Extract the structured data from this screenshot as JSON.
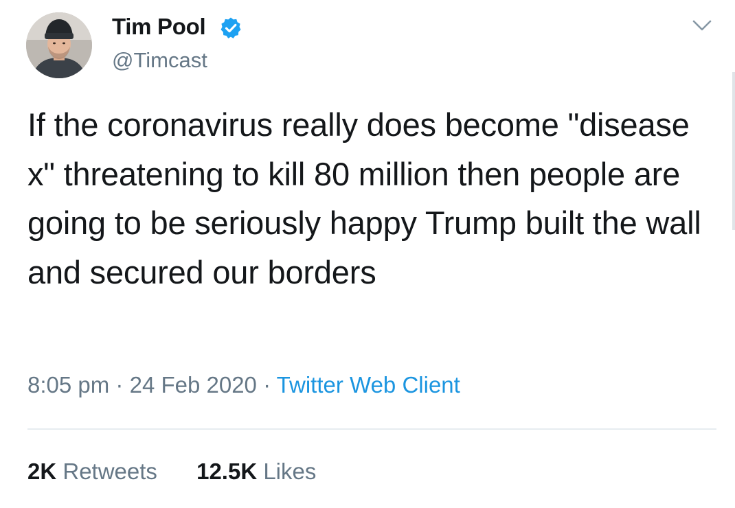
{
  "author": {
    "name": "Tim Pool",
    "handle": "@Timcast",
    "verified": true
  },
  "tweet": {
    "text": "If the coronavirus really does become \"disease x\" threatening to kill 80 million then people are going to be seriously happy Trump built the wall and secured our borders",
    "time": "8:05 pm",
    "separator": "·",
    "date": "24 Feb 2020",
    "source": "Twitter Web Client"
  },
  "stats": {
    "retweets_count": "2K",
    "retweets_label": "Retweets",
    "likes_count": "12.5K",
    "likes_label": "Likes"
  },
  "icons": {
    "verified": "verified-badge-icon",
    "menu": "chevron-down-icon"
  },
  "colors": {
    "text": "#14171a",
    "secondary": "#657786",
    "link": "#1b95e0",
    "verified": "#1da1f2",
    "divider": "#e6ecf0"
  }
}
